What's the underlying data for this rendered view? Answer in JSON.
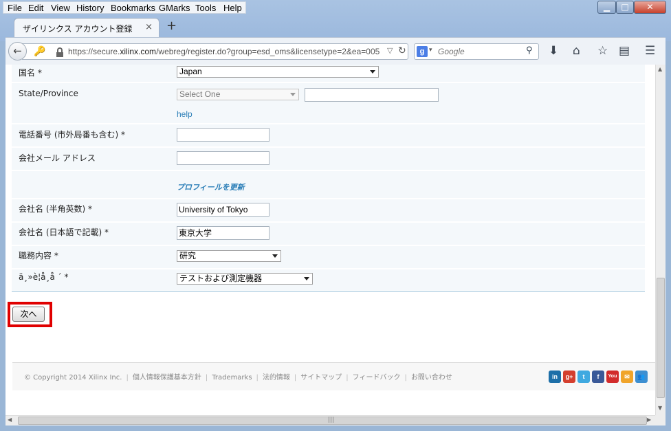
{
  "menu": [
    "File",
    "Edit",
    "View",
    "History",
    "Bookmarks",
    "GMarks",
    "Tools",
    "Help"
  ],
  "window": {
    "min": "▁",
    "max": "□",
    "close": "✕"
  },
  "tab": {
    "title": "ザイリンクス アカウント登録",
    "close": "×",
    "new": "+"
  },
  "url": {
    "prefix": "https://secure.",
    "host": "xilinx.com",
    "path": "/webreg/register.do?group=esd_oms&licensetype=2&ea=005"
  },
  "search": {
    "engine": "g",
    "placeholder": "Google"
  },
  "form": {
    "country": {
      "label": "国名 *",
      "value": "Japan"
    },
    "state": {
      "label": "State/Province",
      "value": "Select One",
      "help": "help"
    },
    "phone": {
      "label": "電話番号 (市外局番も含む) *",
      "value": ""
    },
    "email": {
      "label": "会社メール アドレス",
      "value": ""
    },
    "update_profile": "プロフィールを更新",
    "company_en": {
      "label": "会社名 (半角英数) *",
      "value": "University of Tokyo"
    },
    "company_ja": {
      "label": "会社名 (日本語で記載) *",
      "value": "東京大学"
    },
    "job": {
      "label": "職務内容 *",
      "value": "研究"
    },
    "industry": {
      "label": "ä¸»è¦å¸å ´ *",
      "value": "テストおよび測定機器"
    },
    "next_label": "次へ"
  },
  "footer": {
    "links": [
      "© Copyright 2014 Xilinx Inc.",
      "個人情報保護基本方針",
      "Trademarks",
      "法的情報",
      "サイトマップ",
      "フィードバック",
      "お問い合わせ"
    ],
    "social": [
      {
        "name": "linkedin-icon",
        "glyph": "in",
        "color": "#1d6fa8"
      },
      {
        "name": "googleplus-icon",
        "glyph": "g+",
        "color": "#d43f2e"
      },
      {
        "name": "twitter-icon",
        "glyph": "t",
        "color": "#3fa9e0"
      },
      {
        "name": "facebook-icon",
        "glyph": "f",
        "color": "#3a5998"
      },
      {
        "name": "youtube-icon",
        "glyph": "You",
        "color": "#d22b2b"
      },
      {
        "name": "email-icon",
        "glyph": "✉",
        "color": "#f0a42a"
      },
      {
        "name": "community-icon",
        "glyph": "👥",
        "color": "#3d8fd1"
      }
    ]
  }
}
